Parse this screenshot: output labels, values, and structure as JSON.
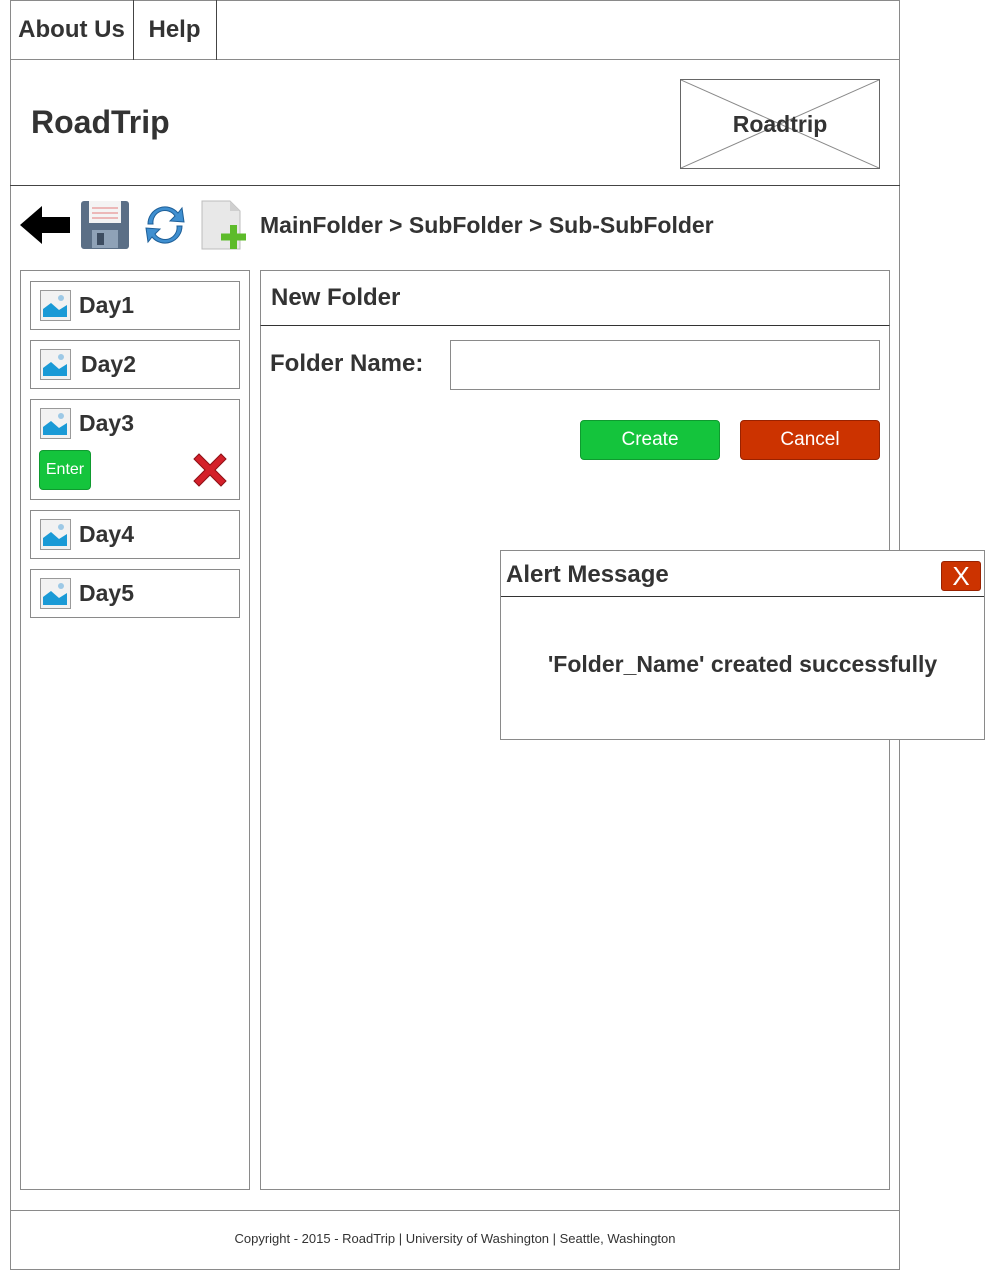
{
  "nav": {
    "items": [
      {
        "label": "About Us"
      },
      {
        "label": "Help"
      }
    ]
  },
  "header": {
    "title": "RoadTrip",
    "logo_text": "Roadtrip"
  },
  "toolbar": {
    "icons": [
      "back-arrow-icon",
      "save-floppy-icon",
      "refresh-icon",
      "new-file-icon"
    ],
    "breadcrumb": "MainFolder > SubFolder > Sub-SubFolder"
  },
  "sidebar": {
    "days": [
      {
        "label": "Day1"
      },
      {
        "label": "Day2"
      },
      {
        "label": "Day3",
        "enter_label": "Enter"
      },
      {
        "label": "Day4"
      },
      {
        "label": "Day5"
      }
    ]
  },
  "form": {
    "title": "New Folder",
    "folder_name_label": "Folder Name:",
    "folder_name_value": "",
    "create_label": "Create",
    "cancel_label": "Cancel"
  },
  "alert": {
    "title": "Alert Message",
    "close_label": "X",
    "message": "'Folder_Name' created successfully"
  },
  "footer": {
    "text": "Copyright - 2015 - RoadTrip | University of Washington | Seattle, Washington"
  },
  "colors": {
    "create_green": "#14c43c",
    "cancel_red": "#cc3300",
    "image_blue": "#1a9ad6"
  }
}
